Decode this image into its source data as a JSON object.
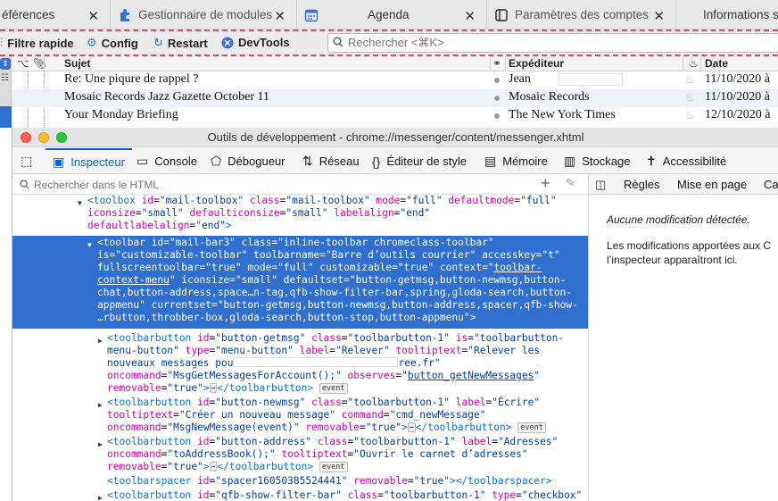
{
  "tabs": [
    {
      "label": "éférences",
      "close": "✕"
    },
    {
      "label": "Gestionnaire de modules",
      "close": "✕"
    },
    {
      "label": "Agenda",
      "close": "✕"
    },
    {
      "label": "Paramètres des comptes (",
      "close": "✕"
    },
    {
      "label": "Informations s",
      "close": ""
    }
  ],
  "mail_toolbar": {
    "quick_filter": "Filtre rapide",
    "config": "Config",
    "restart": "Restart",
    "devtools": "DevTools",
    "search_placeholder": "Rechercher <⌘K>"
  },
  "thread": {
    "columns": {
      "subject": "Sujet",
      "sender": "Expéditeur",
      "date": "Date"
    },
    "rows": [
      {
        "subject": "Re: Une piqure de rappel ?",
        "sender": "Jean",
        "date": "11/10/2020 à"
      },
      {
        "subject": "Mosaic Records Jazz Gazette October 11",
        "sender": "Mosaic Records",
        "date": "11/10/2020 à"
      },
      {
        "subject": "Your Monday Briefing",
        "sender": "The New York Times",
        "date": "12/10/2020 à"
      }
    ]
  },
  "devtools": {
    "title": "Outils de développement - chrome://messenger/content/messenger.xhtml",
    "tabs": [
      "Inspecteur",
      "Console",
      "Débogueur",
      "Réseau",
      "Éditeur de style",
      "Mémoire",
      "Stockage",
      "Accessibilité"
    ],
    "search_placeholder": "Rechercher dans le HTML",
    "side_tabs": [
      "Règles",
      "Mise en page",
      "Cal"
    ],
    "no_changes": "Aucune modification détectée.",
    "changes_line1": "Les modifications apportées aux C",
    "changes_line2": "l’inspecteur apparaîtront ici.",
    "event_badge": "event",
    "ellipsis": "⋯"
  }
}
